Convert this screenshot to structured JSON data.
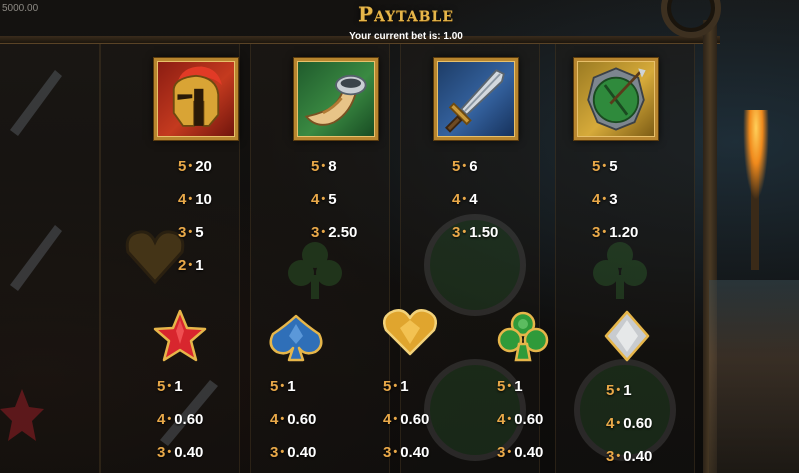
{
  "balance": "5000.00",
  "title": "Paytable",
  "subtitle": "Your current bet is: 1.00",
  "colors": {
    "gold": "#e6b64a",
    "count_orange": "#e9a949",
    "value_white": "#ffffff"
  },
  "high_symbols": [
    {
      "icon": "spartan-helmet-icon",
      "pays": [
        {
          "count": "5",
          "value": "20"
        },
        {
          "count": "4",
          "value": "10"
        },
        {
          "count": "3",
          "value": "5"
        },
        {
          "count": "2",
          "value": "1"
        }
      ]
    },
    {
      "icon": "horn-icon",
      "pays": [
        {
          "count": "5",
          "value": "8"
        },
        {
          "count": "4",
          "value": "5"
        },
        {
          "count": "3",
          "value": "2.50"
        }
      ]
    },
    {
      "icon": "sword-icon",
      "pays": [
        {
          "count": "5",
          "value": "6"
        },
        {
          "count": "4",
          "value": "4"
        },
        {
          "count": "3",
          "value": "1.50"
        }
      ]
    },
    {
      "icon": "shield-icon",
      "pays": [
        {
          "count": "5",
          "value": "5"
        },
        {
          "count": "4",
          "value": "3"
        },
        {
          "count": "3",
          "value": "1.20"
        }
      ]
    }
  ],
  "low_symbols": [
    {
      "icon": "red-star-icon",
      "pays": [
        {
          "count": "5",
          "value": "1"
        },
        {
          "count": "4",
          "value": "0.60"
        },
        {
          "count": "3",
          "value": "0.40"
        }
      ]
    },
    {
      "icon": "blue-spade-icon",
      "pays": [
        {
          "count": "5",
          "value": "1"
        },
        {
          "count": "4",
          "value": "0.60"
        },
        {
          "count": "3",
          "value": "0.40"
        }
      ]
    },
    {
      "icon": "gold-heart-icon",
      "pays": [
        {
          "count": "5",
          "value": "1"
        },
        {
          "count": "4",
          "value": "0.60"
        },
        {
          "count": "3",
          "value": "0.40"
        }
      ]
    },
    {
      "icon": "green-club-icon",
      "pays": [
        {
          "count": "5",
          "value": "1"
        },
        {
          "count": "4",
          "value": "0.60"
        },
        {
          "count": "3",
          "value": "0.40"
        }
      ]
    },
    {
      "icon": "silver-diamond-icon",
      "pays": [
        {
          "count": "5",
          "value": "1"
        },
        {
          "count": "4",
          "value": "0.60"
        },
        {
          "count": "3",
          "value": "0.40"
        }
      ]
    }
  ]
}
